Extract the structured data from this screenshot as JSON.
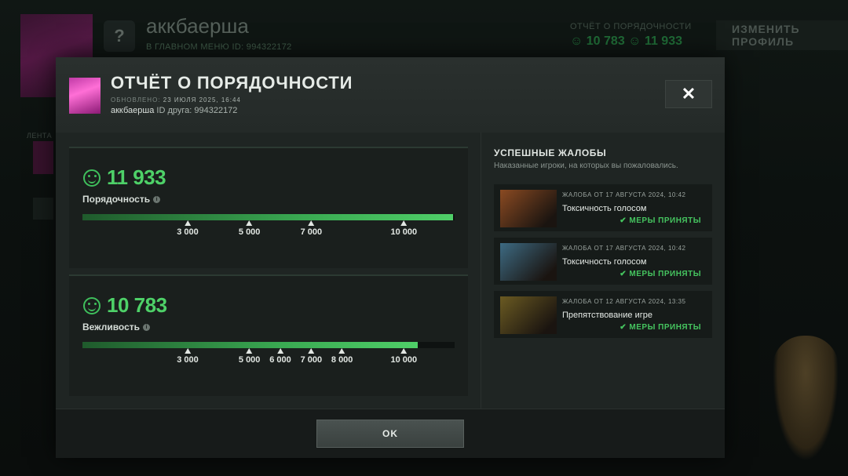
{
  "background": {
    "profile_name": "аккбаерша",
    "status_line": "В ГЛАВНОМ МЕНЮ",
    "id_label": "ID: 994322172",
    "rank_glyph": "?",
    "reputation_label": "ОТЧЁТ О ПОРЯДОЧНОСТИ",
    "reputation_values": "☺ 10 783  ☺ 11 933",
    "edit_profile": "ИЗМЕНИТЬ ПРОФИЛЬ",
    "feed_label": "ЛЕНТА"
  },
  "modal": {
    "title": "ОТЧЁТ О ПОРЯДОЧНОСТИ",
    "updated_prefix": "ОБНОВЛЕНО:",
    "updated_value": "23 ИЮЛЯ 2025, 16:44",
    "user_name": "аккбаерша",
    "friend_id": "ID друга: 994322172",
    "close_glyph": "✕",
    "ok_label": "OK"
  },
  "metrics": [
    {
      "score": "11 933",
      "label": "Порядочность",
      "fill_fraction": 0.995,
      "ticks": [
        "3 000",
        "5 000",
        "7 000",
        "10 000"
      ],
      "tick_values": [
        3000,
        5000,
        7000,
        10000
      ]
    },
    {
      "score": "10 783",
      "label": "Вежливость",
      "fill_fraction": 0.9,
      "ticks": [
        "3 000",
        "5 000",
        "6 000",
        "7 000",
        "8 000",
        "10 000"
      ],
      "tick_values": [
        3000,
        5000,
        6000,
        7000,
        8000,
        10000
      ]
    }
  ],
  "reports_section": {
    "title": "УСПЕШНЫЕ ЖАЛОБЫ",
    "subtitle": "Наказанные игроки, на которых вы пожаловались.",
    "items": [
      {
        "date": "ЖАЛОБА ОТ 17 АВГУСТА 2024, 10:42",
        "reason": "Токсичность голосом",
        "status": "МЕРЫ ПРИНЯТЫ",
        "hero_color": "#8a4a22"
      },
      {
        "date": "ЖАЛОБА ОТ 17 АВГУСТА 2024, 10:42",
        "reason": "Токсичность голосом",
        "status": "МЕРЫ ПРИНЯТЫ",
        "hero_color": "#3d6a82"
      },
      {
        "date": "ЖАЛОБА ОТ 12 АВГУСТА 2024, 13:35",
        "reason": "Препятствование игре",
        "status": "МЕРЫ ПРИНЯТЫ",
        "hero_color": "#6a5a22"
      }
    ]
  },
  "colors": {
    "accent": "#4ed168",
    "panel": "#1f2523"
  }
}
